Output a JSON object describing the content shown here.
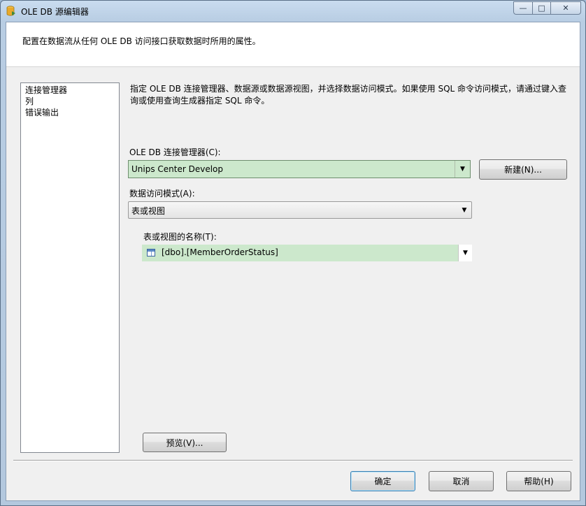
{
  "window": {
    "title": "OLE DB 源编辑器",
    "caption_min": "—",
    "caption_max": "□",
    "caption_close": "✕"
  },
  "header": {
    "description": "配置在数据流从任何 OLE DB 访问接口获取数据时所用的属性。"
  },
  "nav": {
    "items": [
      {
        "label": "连接管理器"
      },
      {
        "label": "列"
      },
      {
        "label": "错误输出"
      }
    ]
  },
  "connection_page": {
    "instructions": "指定 OLE DB 连接管理器、数据源或数据源视图，并选择数据访问模式。如果使用 SQL 命令访问模式，请通过键入查询或使用查询生成器指定 SQL 命令。",
    "conn_manager_label": "OLE DB 连接管理器(C):",
    "conn_manager_value": "Unips Center Develop",
    "new_button": "新建(N)...",
    "access_mode_label": "数据访问模式(A):",
    "access_mode_value": "表或视图",
    "table_label": "表或视图的名称(T):",
    "table_value": "[dbo].[MemberOrderStatus]",
    "preview_button": "预览(V)..."
  },
  "footer": {
    "ok": "确定",
    "cancel": "取消",
    "help": "帮助(H)"
  },
  "icons": {
    "app": "database-source-icon",
    "table": "table-icon",
    "dropdown": "chevron-down-icon"
  },
  "colors": {
    "selected_field": "#cce8cc",
    "default_button_border": "#3c7fb1"
  }
}
